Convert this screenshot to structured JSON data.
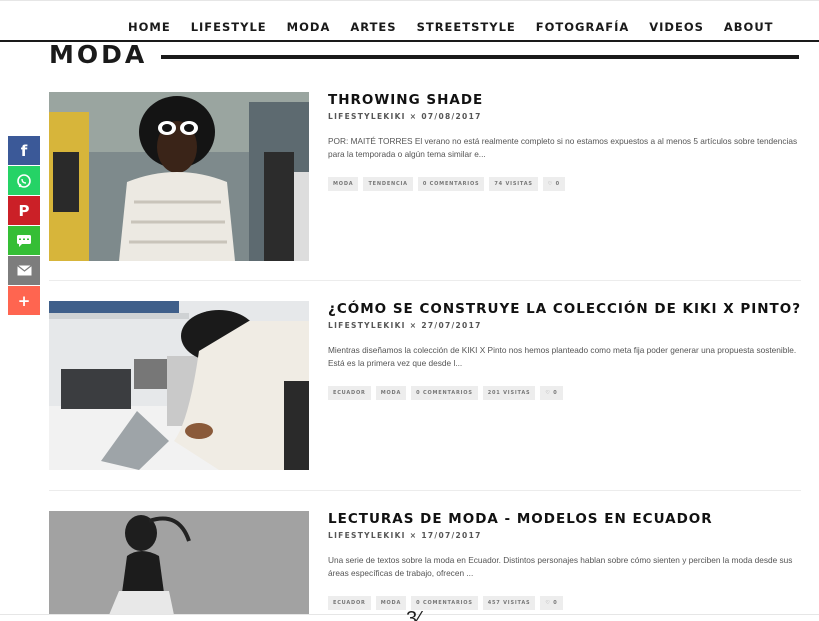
{
  "nav": {
    "items": [
      "HOME",
      "LIFESTYLE",
      "MODA",
      "ARTES",
      "STREETSTYLE",
      "FOTOGRAFÍA",
      "VIDEOS",
      "ABOUT"
    ]
  },
  "section": {
    "title": "MODA"
  },
  "share": {
    "buttons": [
      {
        "icon": "facebook-icon",
        "color": "#3b5998",
        "glyph": "f"
      },
      {
        "icon": "whatsapp-icon",
        "color": "#25d366",
        "glyph": ""
      },
      {
        "icon": "pinterest-icon",
        "color": "#cb2027",
        "glyph": "P"
      },
      {
        "icon": "sms-icon",
        "color": "#35be35",
        "glyph": ""
      },
      {
        "icon": "email-icon",
        "color": "#7d7d7d",
        "glyph": ""
      },
      {
        "icon": "plus-icon",
        "color": "#ff6550",
        "glyph": "+"
      }
    ]
  },
  "posts": [
    {
      "title": "THROWING SHADE",
      "author": "LIFESTYLEKIKI",
      "separator": "×",
      "date": "07/08/2017",
      "excerpt": "POR: MAITÉ TORRES El verano no está realmente completo si no estamos expuestos a al menos 5 artículos sobre tendencias para la temporada o algún tema similar e...",
      "tags": [
        "MODA",
        "TENDENCIA",
        "0 COMENTARIOS",
        "74 VISITAS",
        "♡ 0"
      ]
    },
    {
      "title": "¿CÓMO SE CONSTRUYE LA COLECCIÓN DE KIKI X PINTO?",
      "author": "LIFESTYLEKIKI",
      "separator": "×",
      "date": "27/07/2017",
      "excerpt": "Mientras diseñamos la colección de KIKI X Pinto nos hemos planteado como meta fija poder generar una propuesta sostenible. Está es la primera vez que desde l...",
      "tags": [
        "ECUADOR",
        "MODA",
        "0 COMENTARIOS",
        "201 VISITAS",
        "♡ 0"
      ]
    },
    {
      "title": "LECTURAS DE MODA - MODELOS EN ECUADOR",
      "author": "LIFESTYLEKIKI",
      "separator": "×",
      "date": "17/07/2017",
      "excerpt": "Una serie de textos sobre la moda en Ecuador. Distintos personajes hablan sobre cómo sienten y perciben la moda desde sus áreas específicas de trabajo, ofrecen ...",
      "tags": [
        "ECUADOR",
        "MODA",
        "0 COMENTARIOS",
        "457 VISITAS",
        "♡ 0"
      ]
    }
  ],
  "footer": {
    "glyph": "3⁄"
  }
}
